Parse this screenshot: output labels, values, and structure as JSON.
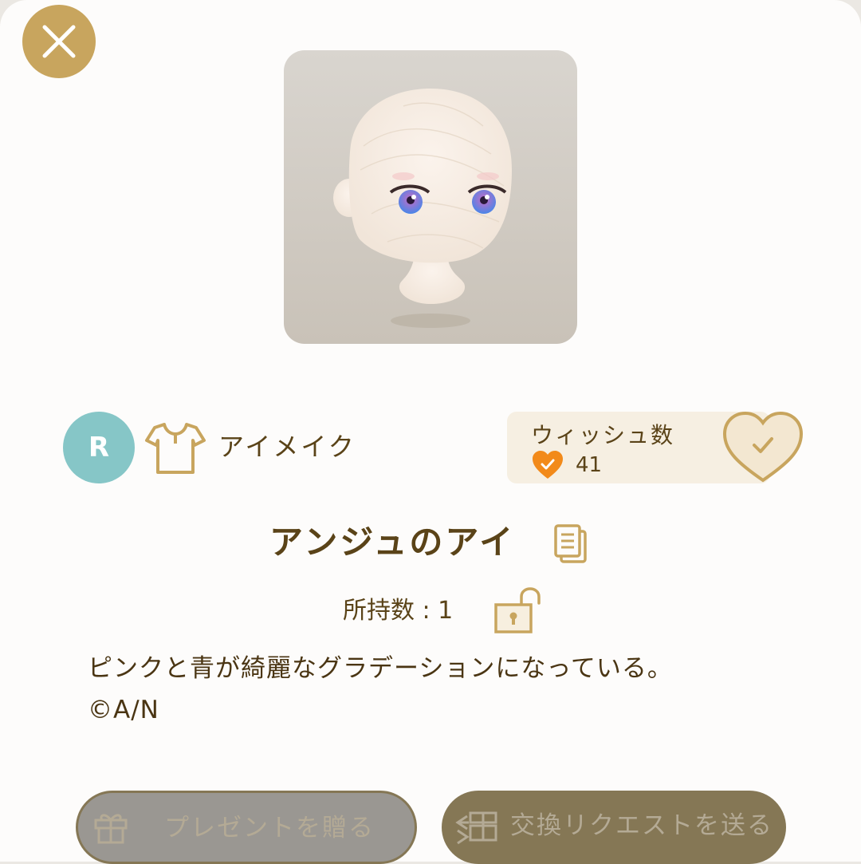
{
  "header": {
    "close_icon": "close-x-icon"
  },
  "item": {
    "rarity": "R",
    "category_icon": "shirt-icon",
    "category": "アイメイク",
    "name": "アンジュのアイ",
    "owned": "所持数 : 1",
    "description": "ピンクと青が綺麗なグラデーションになっている。",
    "copyright": "©A/N"
  },
  "wish": {
    "label": "ウィッシュ数",
    "count": "41",
    "heart_color": "#f28a1a"
  },
  "actions": {
    "present_label": "プレゼントを贈る",
    "exchange_label": "交換リクエストを送る"
  },
  "colors": {
    "accent_gold": "#c8a55e",
    "text_brown": "#5a4318",
    "rarity_teal": "#86c6c7"
  }
}
